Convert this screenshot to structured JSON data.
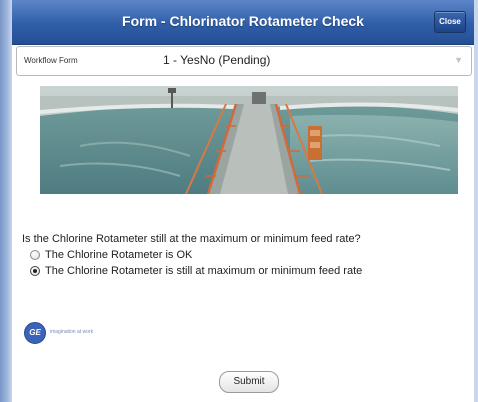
{
  "window": {
    "title": "Form - Chlorinator Rotameter Check",
    "close_label": "Close"
  },
  "workflow": {
    "label": "Workflow Form",
    "value": "1 - YesNo (Pending)",
    "chevron_icon": "chevron-down-icon"
  },
  "photo": {
    "description_icon": "water-treatment-tank-photo"
  },
  "question": {
    "text": "Is the Chlorine Rotameter still at the maximum or minimum feed rate?",
    "options": [
      {
        "label": "The Chlorine Rotameter is OK",
        "selected": false
      },
      {
        "label": "The Chlorine Rotameter is still at maximum or minimum feed rate",
        "selected": true
      }
    ]
  },
  "branding": {
    "logo_text": "GE",
    "tagline": "imagination at work"
  },
  "actions": {
    "submit_label": "Submit"
  },
  "colors": {
    "titlebar": "#2f5ea8",
    "logo": "#3b63b8"
  }
}
